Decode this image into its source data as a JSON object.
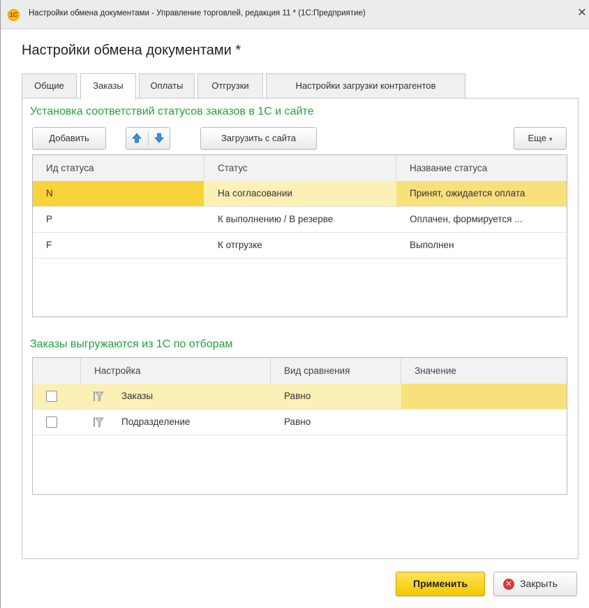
{
  "window": {
    "app_logo": "1С",
    "title": "Настройки обмена документами - Управление торговлей, редакция 11 * (1С:Предприятие)",
    "close_glyph": "✕"
  },
  "form": {
    "title": "Настройки обмена документами *"
  },
  "tabs": [
    {
      "label": "Общие",
      "active": false
    },
    {
      "label": "Заказы",
      "active": true
    },
    {
      "label": "Оплаты",
      "active": false
    },
    {
      "label": "Отгрузки",
      "active": false
    },
    {
      "label": "Настройки загрузки контрагентов",
      "active": false
    }
  ],
  "statuses": {
    "section_title": "Установка соответствий статусов заказов в 1С и сайте",
    "toolbar": {
      "add_label": "Добавить",
      "up_icon": "arrow-up-icon",
      "down_icon": "arrow-down-icon",
      "load_label": "Загрузить с сайта",
      "more_label": "Еще",
      "more_caret": "▾"
    },
    "columns": [
      "Ид статуса",
      "Статус",
      "Название статуса"
    ],
    "rows": [
      {
        "id": "N",
        "status": "На согласовании",
        "name": "Принят, ожидается оплата",
        "selected": true
      },
      {
        "id": "P",
        "status": "К выполнению / В резерве",
        "name": "Оплачен, формируется ...",
        "selected": false
      },
      {
        "id": "F",
        "status": "К отгрузке",
        "name": "Выполнен",
        "selected": false
      }
    ]
  },
  "filters": {
    "section_title": "Заказы выгружаются из 1С по отборам",
    "columns": [
      "",
      "Настройка",
      "Вид сравнения",
      "Значение"
    ],
    "rows": [
      {
        "checked": false,
        "icon": "filter-icon",
        "setting": "Заказы",
        "comparison": "Равно",
        "value": "",
        "selected": true
      },
      {
        "checked": false,
        "icon": "filter-icon",
        "setting": "Подразделение",
        "comparison": "Равно",
        "value": "",
        "selected": false
      }
    ]
  },
  "footer": {
    "apply_label": "Применить",
    "close_label": "Закрыть",
    "close_icon": "close-circle-icon"
  },
  "colors": {
    "accent_green": "#22a33a",
    "selection_yellow": "#f8d33a",
    "row_highlight": "#fbf0b6",
    "primary_button": "#f4c800"
  }
}
